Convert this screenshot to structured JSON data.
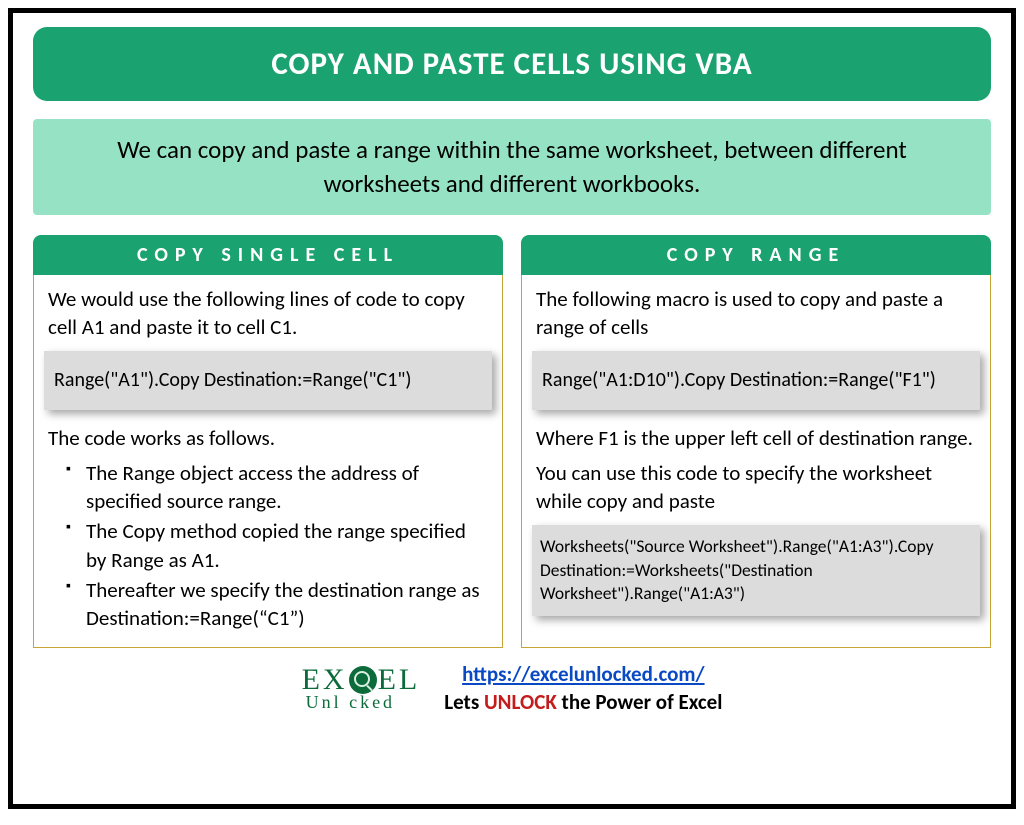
{
  "title": "COPY AND PASTE CELLS USING VBA",
  "subtitle": "We can copy and paste a range within the same worksheet, between different worksheets and different workbooks.",
  "left": {
    "heading": "COPY SINGLE CELL",
    "intro": "We would use the following lines of code to copy cell A1 and paste it to cell C1.",
    "code1": "Range(\"A1\").Copy Destination:=Range(\"C1\")",
    "explain": "The code works as follows.",
    "bullets": [
      "The Range object access the address of specified source range.",
      "The Copy method copied the range specified by Range as A1.",
      "Thereafter we specify the destination range as Destination:=Range(“C1”)"
    ]
  },
  "right": {
    "heading": "COPY RANGE",
    "intro": "The following macro is used to copy and paste a range of cells",
    "code1": "Range(\"A1:D10\").Copy Destination:=Range(\"F1\")",
    "explain1": "Where F1 is the upper left cell of destination range.",
    "explain2": "You can use this code to specify the worksheet while copy and paste",
    "code2": "Worksheets(\"Source Worksheet\").Range(\"A1:A3\").Copy Destination:=Worksheets(\"Destination Worksheet\").Range(\"A1:A3\")"
  },
  "footer": {
    "logo_top_left": "EX",
    "logo_top_right": "EL",
    "logo_bottom": "Unl   cked",
    "url": "https://excelunlocked.com/",
    "tagline_pre": "Lets ",
    "tagline_mid": "UNLOCK",
    "tagline_post": " the Power of Excel"
  }
}
